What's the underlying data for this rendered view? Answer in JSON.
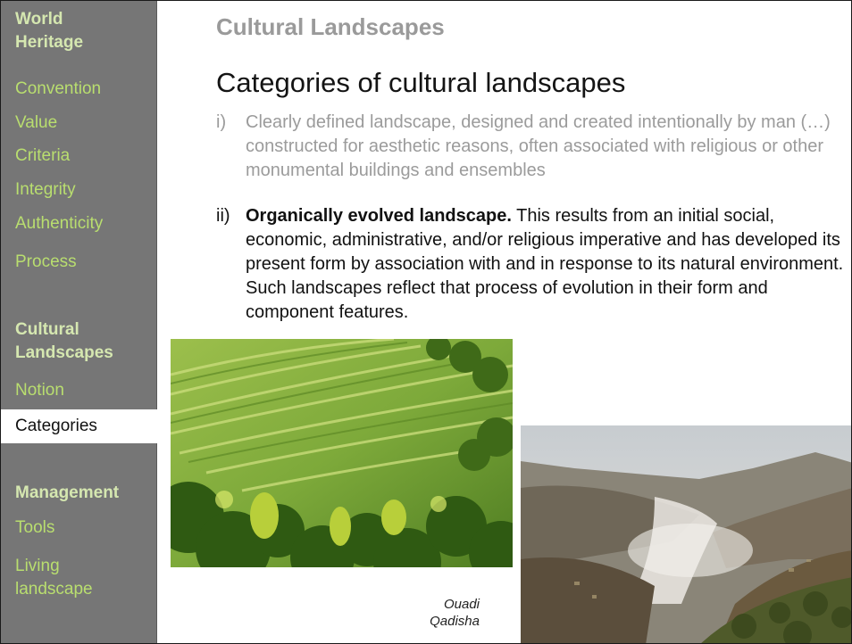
{
  "sidebar": {
    "groups": [
      {
        "heading": "World Heritage",
        "items": [
          "Convention",
          "Value",
          "Criteria",
          "Integrity",
          "Authenticity",
          "Process"
        ]
      },
      {
        "heading": "Cultural Landscapes",
        "items": [
          "Notion"
        ],
        "active_item": "Categories"
      },
      {
        "heading": "Management",
        "items": [
          "Tools",
          "Living landscape"
        ]
      }
    ]
  },
  "main": {
    "section_title": "Cultural Landscapes",
    "heading": "Categories of cultural landscapes",
    "items": [
      {
        "number": "i)",
        "bold": "",
        "text": "Clearly defined landscape, designed and created intentionally by man (…) constructed for aesthetic reasons, often associated with religious or other monumental buildings and ensembles"
      },
      {
        "number": "ii)",
        "bold": "Organically evolved landscape.",
        "text": " This results from an initial social, economic, administrative, and/or religious imperative and has developed its present form by association with and in response to its natural environment. Such landscapes reflect that process of evolution in their form and component features."
      }
    ],
    "caption": "Ouadi Qadisha"
  },
  "colors": {
    "sidebar_bg": "#767676",
    "nav_heading": "#d5e7b0",
    "nav_link": "#b9de6f",
    "active_bg": "#ffffff",
    "muted_text": "#9b9b9b",
    "text": "#111111"
  }
}
